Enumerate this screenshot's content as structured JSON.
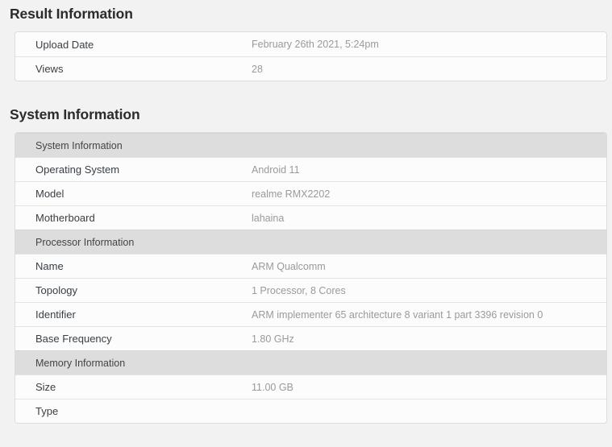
{
  "result_information": {
    "heading": "Result Information",
    "rows": [
      {
        "label": "Upload Date",
        "value": "February 26th 2021, 5:24pm"
      },
      {
        "label": "Views",
        "value": "28"
      }
    ]
  },
  "system_information": {
    "heading": "System Information",
    "groups": [
      {
        "title": "System Information",
        "rows": [
          {
            "label": "Operating System",
            "value": "Android 11"
          },
          {
            "label": "Model",
            "value": "realme RMX2202"
          },
          {
            "label": "Motherboard",
            "value": "lahaina"
          }
        ]
      },
      {
        "title": "Processor Information",
        "rows": [
          {
            "label": "Name",
            "value": "ARM Qualcomm"
          },
          {
            "label": "Topology",
            "value": "1 Processor, 8 Cores"
          },
          {
            "label": "Identifier",
            "value": "ARM implementer 65 architecture 8 variant 1 part 3396 revision 0"
          },
          {
            "label": "Base Frequency",
            "value": "1.80 GHz"
          }
        ]
      },
      {
        "title": "Memory Information",
        "rows": [
          {
            "label": "Size",
            "value": "11.00 GB"
          },
          {
            "label": "Type",
            "value": ""
          }
        ]
      }
    ]
  },
  "colors": {
    "page_background": "#f2f2f2",
    "panel_background": "#fcfcfc",
    "panel_border": "#dcdcdc",
    "group_header_background": "#dddddd",
    "label_text": "#3a3f44",
    "value_text": "#9a9a9a",
    "heading_text": "#2b2b2b"
  }
}
